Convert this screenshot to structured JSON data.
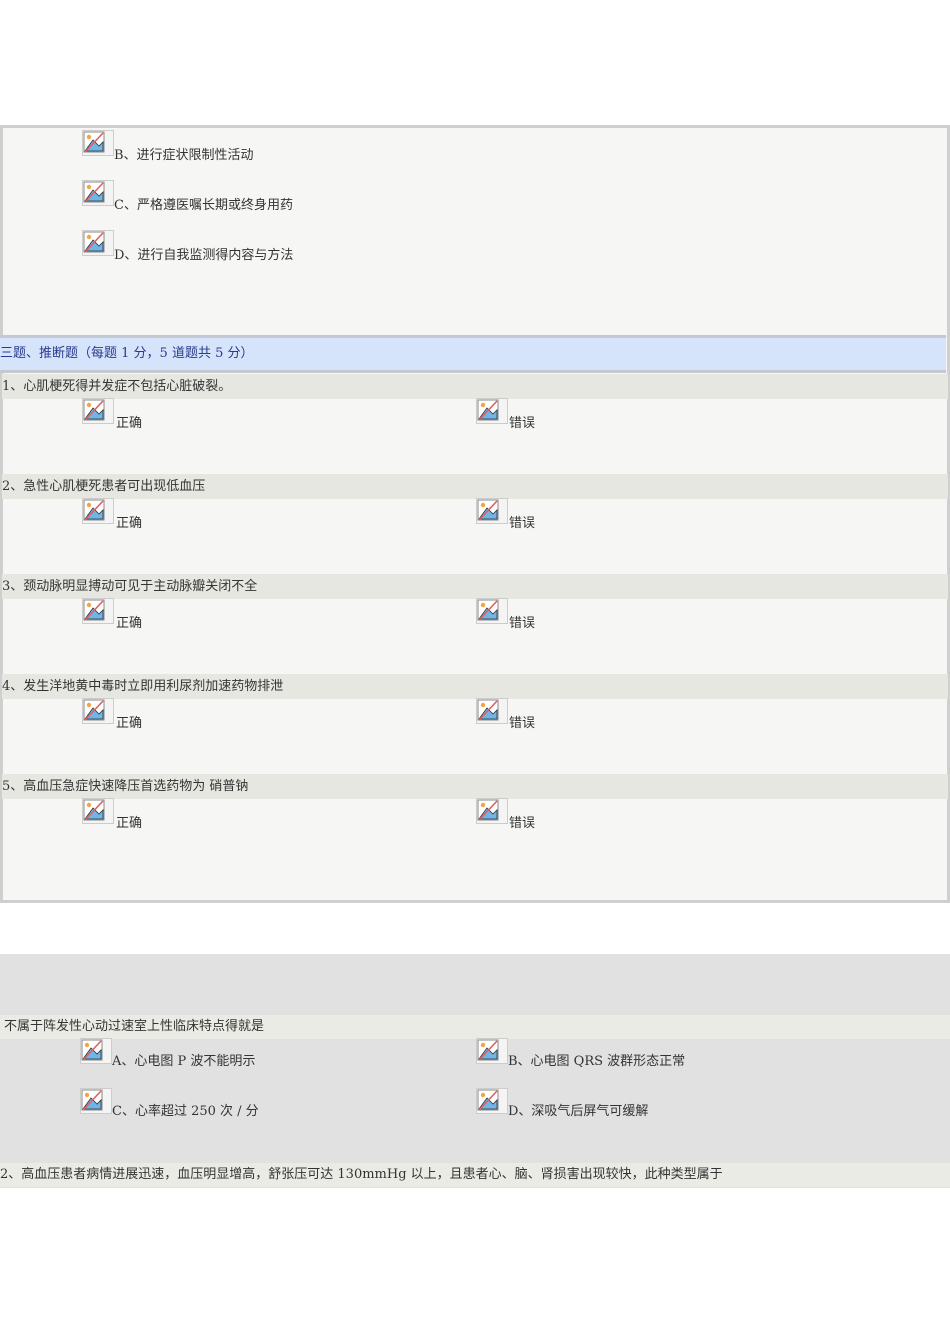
{
  "section1_options": [
    "B、进行症状限制性活动",
    "C、严格遵医嘱长期或终身用药",
    "D、进行自我监测得内容与方法"
  ],
  "section2": {
    "header": "三题、推断题（每题 1 分，5 道题共 5 分）",
    "true_label": "正确",
    "false_label": "错误",
    "questions": [
      "1、心肌梗死得并发症不包括心脏破裂。",
      "2、急性心肌梗死患者可出现低血压",
      "3、颈动脉明显搏动可见于主动脉瓣关闭不全",
      "4、发生洋地黄中毒时立即用利尿剂加速药物排泄",
      "5、高血压急症快速降压首选药物为 硝普钠"
    ]
  },
  "section3": {
    "q1": "不属于阵发性心动过速室上性临床特点得就是",
    "q1_options": [
      "A、心电图 P 波不能明示",
      "B、心电图 QRS 波群形态正常",
      "C、心率超过 250 次 / 分",
      "D、深吸气后屏气可缓解"
    ],
    "q2": "2、高血压患者病情进展迅速，血压明显增高，舒张压可达 130mmHg 以上，且患者心、脑、肾损害出现较快，此种类型属于"
  }
}
